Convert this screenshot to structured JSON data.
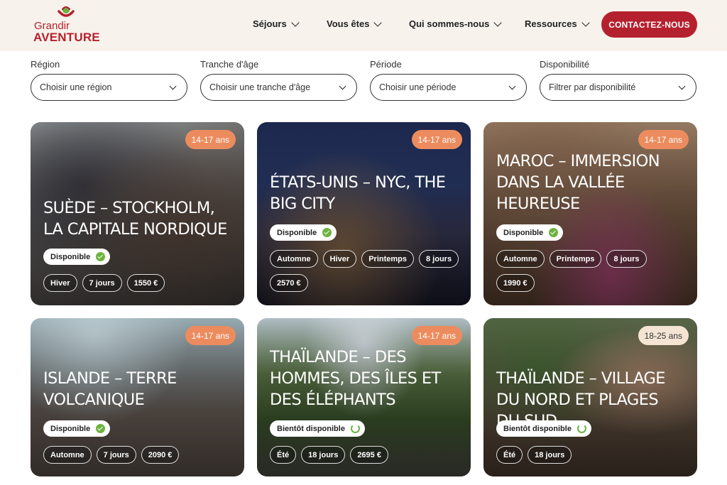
{
  "brand": {
    "line1": "Grandir",
    "line2": "AVENTURE",
    "color": "#b5202e"
  },
  "nav": {
    "items": [
      {
        "label": "Séjours"
      },
      {
        "label": "Vous êtes"
      },
      {
        "label": "Qui sommes-nous"
      },
      {
        "label": "Ressources"
      }
    ],
    "cta": "CONTACTEZ-NOUS"
  },
  "filters": [
    {
      "label": "Région",
      "placeholder": "Choisir une région"
    },
    {
      "label": "Tranche d'âge",
      "placeholder": "Choisir une tranche d'âge"
    },
    {
      "label": "Période",
      "placeholder": "Choisir une période"
    },
    {
      "label": "Disponibilité",
      "placeholder": "Filtrer par disponibilité"
    }
  ],
  "cards": [
    {
      "age": "14-17 ans",
      "title": "Suède – Stockholm, la capitale nordique",
      "status": "Disponible",
      "status_kind": "available",
      "tags": [
        "Hiver",
        "7 jours",
        "1550 €"
      ]
    },
    {
      "age": "14-17 ans",
      "title": "États-Unis – NYC, the big city",
      "status": "Disponible",
      "status_kind": "available",
      "tags": [
        "Automne",
        "Hiver",
        "Printemps",
        "8 jours",
        "2570 €"
      ]
    },
    {
      "age": "14-17 ans",
      "title": "Maroc – Immersion dans la vallée heureuse",
      "status": "Disponible",
      "status_kind": "available",
      "tags": [
        "Automne",
        "Printemps",
        "8 jours",
        "1990 €"
      ]
    },
    {
      "age": "14-17 ans",
      "title": "Islande – Terre volcanique",
      "status": "Disponible",
      "status_kind": "available",
      "tags": [
        "Automne",
        "7 jours",
        "2090 €"
      ]
    },
    {
      "age": "14-17 ans",
      "title": "Thaïlande – Des hommes, des îles et des éléphants",
      "status": "Bientôt disponible",
      "status_kind": "soon",
      "tags": [
        "Été",
        "18 jours",
        "2695 €"
      ]
    },
    {
      "age": "18-25 ans",
      "title": "Thaïlande – Village du nord et plages du sud",
      "status": "Bientôt disponible",
      "status_kind": "soon",
      "tags": [
        "Été",
        "18 jours"
      ]
    }
  ]
}
